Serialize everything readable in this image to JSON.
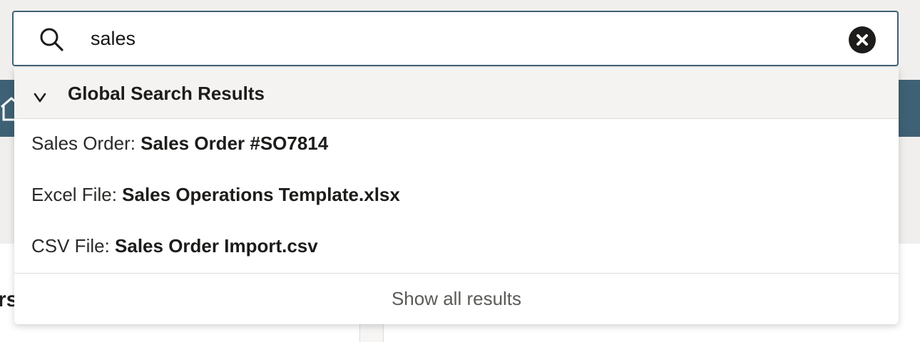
{
  "search": {
    "value": "sales",
    "clear_icon": "close-circle-icon",
    "search_icon": "search-icon"
  },
  "dropdown": {
    "group_title": "Global Search Results",
    "results": [
      {
        "type_label": "Sales Order: ",
        "name": "Sales Order #SO7814"
      },
      {
        "type_label": "Excel File: ",
        "name": "Sales Operations Template.xlsx"
      },
      {
        "type_label": "CSV File: ",
        "name": "Sales Order Import.csv"
      }
    ],
    "show_all_label": "Show all results"
  },
  "background": {
    "partial_text": "rs"
  },
  "colors": {
    "accent": "#3f6175",
    "header_bg": "#f4f3f1",
    "clear_button": "#1d1c1a"
  }
}
